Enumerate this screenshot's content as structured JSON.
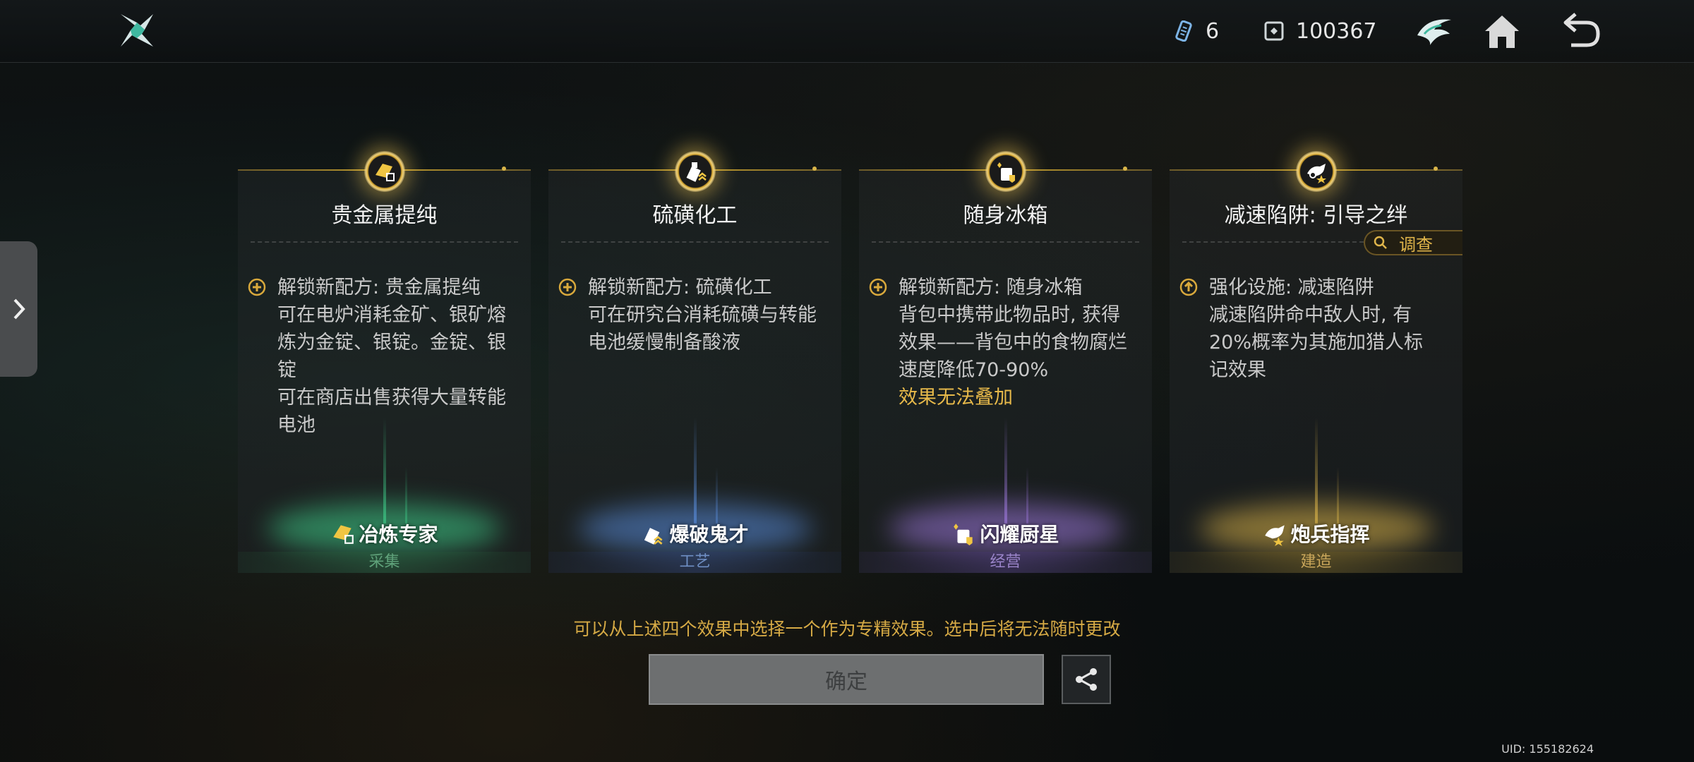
{
  "topbar": {
    "currency1_value": "6",
    "currency2_value": "100367"
  },
  "cards": [
    {
      "title": "贵金属提纯",
      "lines": [
        "解锁新配方: 贵金属提纯",
        "可在电炉消耗金矿、银矿熔",
        "炼为金锭、银锭。金锭、银锭",
        "可在商店出售获得大量转能",
        "电池"
      ],
      "note": "",
      "talent": "冶炼专家",
      "category": "采集",
      "category_color": "#5fa27a",
      "accent": "#3fd28c"
    },
    {
      "title": "硫磺化工",
      "lines": [
        "解锁新配方: 硫磺化工",
        "可在研究台消耗硫磺与转能",
        "电池缓慢制备酸液"
      ],
      "note": "",
      "talent": "爆破鬼才",
      "category": "工艺",
      "category_color": "#6f8fc4",
      "accent": "#5a8fe0"
    },
    {
      "title": "随身冰箱",
      "lines": [
        "解锁新配方: 随身冰箱",
        "背包中携带此物品时, 获得",
        "效果——背包中的食物腐烂",
        "速度降低70-90%"
      ],
      "note": "效果无法叠加",
      "talent": "闪耀厨星",
      "category": "经营",
      "category_color": "#9a84c9",
      "accent": "#a07ae0"
    },
    {
      "title": "减速陷阱: 引导之绊",
      "lines": [
        "强化设施: 减速陷阱",
        "减速陷阱命中敌人时, 有",
        "20%概率为其施加猎人标",
        "记效果"
      ],
      "note": "",
      "talent": "炮兵指挥",
      "category": "建造",
      "category_color": "#c9a65a",
      "accent": "#e0b84a",
      "inspect_label": "调查"
    }
  ],
  "hint": "可以从上述四个效果中选择一个作为专精效果。选中后将无法随时更改",
  "confirm_label": "确定",
  "uid": "UID: 155182624"
}
